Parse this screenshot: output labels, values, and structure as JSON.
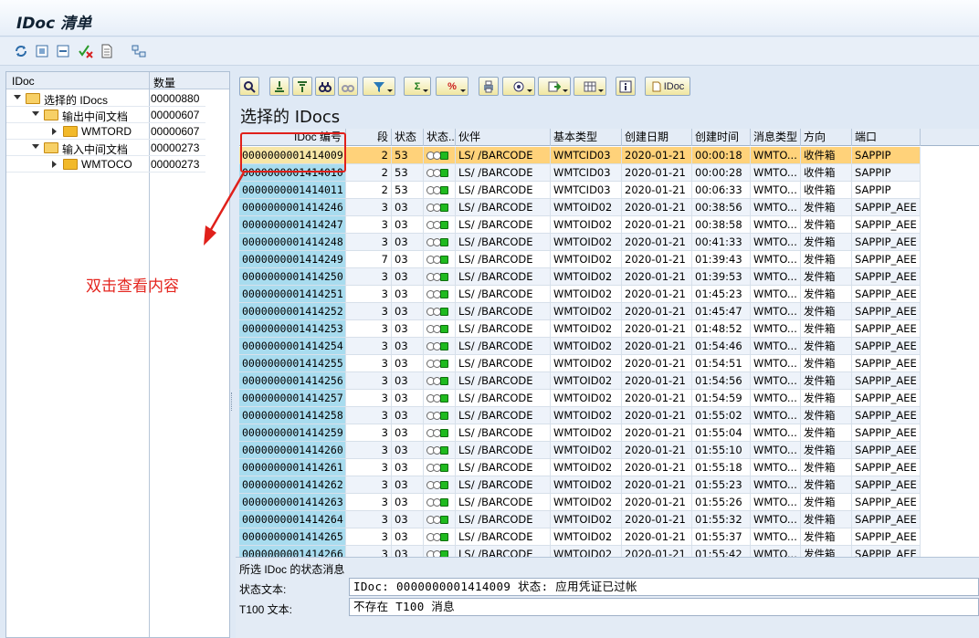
{
  "window": {
    "title": "IDoc 清单"
  },
  "app_toolbar": {
    "icons": [
      "refresh-icon",
      "expand-icon",
      "collapse-icon",
      "delete-check-icon",
      "document-icon",
      "hierarchy-icon"
    ]
  },
  "tree": {
    "headers": {
      "name": "IDoc",
      "count": "数量"
    },
    "nodes": [
      {
        "label": "选择的 IDocs",
        "count": "00000880",
        "level": 0,
        "expanded": true
      },
      {
        "label": "输出中间文档",
        "count": "00000607",
        "level": 1,
        "expanded": true
      },
      {
        "label": "WMTORD",
        "count": "00000607",
        "level": 2,
        "expanded": false
      },
      {
        "label": "输入中间文档",
        "count": "00000273",
        "level": 1,
        "expanded": true
      },
      {
        "label": "WMTOCO",
        "count": "00000273",
        "level": 2,
        "expanded": false
      }
    ]
  },
  "alv_toolbar": {
    "idoc_button": "IDoc"
  },
  "grid": {
    "title": "选择的 IDocs",
    "columns": [
      "IDoc 编号",
      "段",
      "状态",
      "状态...",
      "伙伴",
      "基本类型",
      "创建日期",
      "创建时间",
      "消息类型",
      "方向",
      "端口"
    ],
    "rows": [
      {
        "idoc": "0000000001414009",
        "seg": "2",
        "status": "53",
        "partner": "LS/  /BARCODE",
        "basic": "WMTCID03",
        "date": "2020-01-21",
        "time": "00:00:18",
        "msg": "WMTO...",
        "dir": "收件箱",
        "port": "SAPPIP",
        "selected": true
      },
      {
        "idoc": "0000000001414010",
        "seg": "2",
        "status": "53",
        "partner": "LS/  /BARCODE",
        "basic": "WMTCID03",
        "date": "2020-01-21",
        "time": "00:00:28",
        "msg": "WMTO...",
        "dir": "收件箱",
        "port": "SAPPIP"
      },
      {
        "idoc": "0000000001414011",
        "seg": "2",
        "status": "53",
        "partner": "LS/  /BARCODE",
        "basic": "WMTCID03",
        "date": "2020-01-21",
        "time": "00:06:33",
        "msg": "WMTO...",
        "dir": "收件箱",
        "port": "SAPPIP"
      },
      {
        "idoc": "0000000001414246",
        "seg": "3",
        "status": "03",
        "partner": "LS/  /BARCODE",
        "basic": "WMTOID02",
        "date": "2020-01-21",
        "time": "00:38:56",
        "msg": "WMTO...",
        "dir": "发件箱",
        "port": "SAPPIP_AEE"
      },
      {
        "idoc": "0000000001414247",
        "seg": "3",
        "status": "03",
        "partner": "LS/  /BARCODE",
        "basic": "WMTOID02",
        "date": "2020-01-21",
        "time": "00:38:58",
        "msg": "WMTO...",
        "dir": "发件箱",
        "port": "SAPPIP_AEE"
      },
      {
        "idoc": "0000000001414248",
        "seg": "3",
        "status": "03",
        "partner": "LS/  /BARCODE",
        "basic": "WMTOID02",
        "date": "2020-01-21",
        "time": "00:41:33",
        "msg": "WMTO...",
        "dir": "发件箱",
        "port": "SAPPIP_AEE"
      },
      {
        "idoc": "0000000001414249",
        "seg": "7",
        "status": "03",
        "partner": "LS/  /BARCODE",
        "basic": "WMTOID02",
        "date": "2020-01-21",
        "time": "01:39:43",
        "msg": "WMTO...",
        "dir": "发件箱",
        "port": "SAPPIP_AEE"
      },
      {
        "idoc": "0000000001414250",
        "seg": "3",
        "status": "03",
        "partner": "LS/  /BARCODE",
        "basic": "WMTOID02",
        "date": "2020-01-21",
        "time": "01:39:53",
        "msg": "WMTO...",
        "dir": "发件箱",
        "port": "SAPPIP_AEE"
      },
      {
        "idoc": "0000000001414251",
        "seg": "3",
        "status": "03",
        "partner": "LS/  /BARCODE",
        "basic": "WMTOID02",
        "date": "2020-01-21",
        "time": "01:45:23",
        "msg": "WMTO...",
        "dir": "发件箱",
        "port": "SAPPIP_AEE"
      },
      {
        "idoc": "0000000001414252",
        "seg": "3",
        "status": "03",
        "partner": "LS/  /BARCODE",
        "basic": "WMTOID02",
        "date": "2020-01-21",
        "time": "01:45:47",
        "msg": "WMTO...",
        "dir": "发件箱",
        "port": "SAPPIP_AEE"
      },
      {
        "idoc": "0000000001414253",
        "seg": "3",
        "status": "03",
        "partner": "LS/  /BARCODE",
        "basic": "WMTOID02",
        "date": "2020-01-21",
        "time": "01:48:52",
        "msg": "WMTO...",
        "dir": "发件箱",
        "port": "SAPPIP_AEE"
      },
      {
        "idoc": "0000000001414254",
        "seg": "3",
        "status": "03",
        "partner": "LS/  /BARCODE",
        "basic": "WMTOID02",
        "date": "2020-01-21",
        "time": "01:54:46",
        "msg": "WMTO...",
        "dir": "发件箱",
        "port": "SAPPIP_AEE"
      },
      {
        "idoc": "0000000001414255",
        "seg": "3",
        "status": "03",
        "partner": "LS/  /BARCODE",
        "basic": "WMTOID02",
        "date": "2020-01-21",
        "time": "01:54:51",
        "msg": "WMTO...",
        "dir": "发件箱",
        "port": "SAPPIP_AEE"
      },
      {
        "idoc": "0000000001414256",
        "seg": "3",
        "status": "03",
        "partner": "LS/  /BARCODE",
        "basic": "WMTOID02",
        "date": "2020-01-21",
        "time": "01:54:56",
        "msg": "WMTO...",
        "dir": "发件箱",
        "port": "SAPPIP_AEE"
      },
      {
        "idoc": "0000000001414257",
        "seg": "3",
        "status": "03",
        "partner": "LS/  /BARCODE",
        "basic": "WMTOID02",
        "date": "2020-01-21",
        "time": "01:54:59",
        "msg": "WMTO...",
        "dir": "发件箱",
        "port": "SAPPIP_AEE"
      },
      {
        "idoc": "0000000001414258",
        "seg": "3",
        "status": "03",
        "partner": "LS/  /BARCODE",
        "basic": "WMTOID02",
        "date": "2020-01-21",
        "time": "01:55:02",
        "msg": "WMTO...",
        "dir": "发件箱",
        "port": "SAPPIP_AEE"
      },
      {
        "idoc": "0000000001414259",
        "seg": "3",
        "status": "03",
        "partner": "LS/  /BARCODE",
        "basic": "WMTOID02",
        "date": "2020-01-21",
        "time": "01:55:04",
        "msg": "WMTO...",
        "dir": "发件箱",
        "port": "SAPPIP_AEE"
      },
      {
        "idoc": "0000000001414260",
        "seg": "3",
        "status": "03",
        "partner": "LS/  /BARCODE",
        "basic": "WMTOID02",
        "date": "2020-01-21",
        "time": "01:55:10",
        "msg": "WMTO...",
        "dir": "发件箱",
        "port": "SAPPIP_AEE"
      },
      {
        "idoc": "0000000001414261",
        "seg": "3",
        "status": "03",
        "partner": "LS/  /BARCODE",
        "basic": "WMTOID02",
        "date": "2020-01-21",
        "time": "01:55:18",
        "msg": "WMTO...",
        "dir": "发件箱",
        "port": "SAPPIP_AEE"
      },
      {
        "idoc": "0000000001414262",
        "seg": "3",
        "status": "03",
        "partner": "LS/  /BARCODE",
        "basic": "WMTOID02",
        "date": "2020-01-21",
        "time": "01:55:23",
        "msg": "WMTO...",
        "dir": "发件箱",
        "port": "SAPPIP_AEE"
      },
      {
        "idoc": "0000000001414263",
        "seg": "3",
        "status": "03",
        "partner": "LS/  /BARCODE",
        "basic": "WMTOID02",
        "date": "2020-01-21",
        "time": "01:55:26",
        "msg": "WMTO...",
        "dir": "发件箱",
        "port": "SAPPIP_AEE"
      },
      {
        "idoc": "0000000001414264",
        "seg": "3",
        "status": "03",
        "partner": "LS/  /BARCODE",
        "basic": "WMTOID02",
        "date": "2020-01-21",
        "time": "01:55:32",
        "msg": "WMTO...",
        "dir": "发件箱",
        "port": "SAPPIP_AEE"
      },
      {
        "idoc": "0000000001414265",
        "seg": "3",
        "status": "03",
        "partner": "LS/  /BARCODE",
        "basic": "WMTOID02",
        "date": "2020-01-21",
        "time": "01:55:37",
        "msg": "WMTO...",
        "dir": "发件箱",
        "port": "SAPPIP_AEE"
      },
      {
        "idoc": "0000000001414266",
        "seg": "3",
        "status": "03",
        "partner": "LS/  /BARCODE",
        "basic": "WMTOID02",
        "date": "2020-01-21",
        "time": "01:55:42",
        "msg": "WMTO...",
        "dir": "发件箱",
        "port": "SAPPIP_AEE"
      }
    ]
  },
  "annotation": {
    "text": "双击查看内容",
    "color": "#e4261f"
  },
  "status_panel": {
    "header": "所选 IDoc 的状态消息",
    "status_text_label": "状态文本:",
    "status_text_value": "IDoc: 0000000001414009 状态: 应用凭证已过帐",
    "t100_label": "T100 文本:",
    "t100_value": "不存在 T100 消息"
  }
}
